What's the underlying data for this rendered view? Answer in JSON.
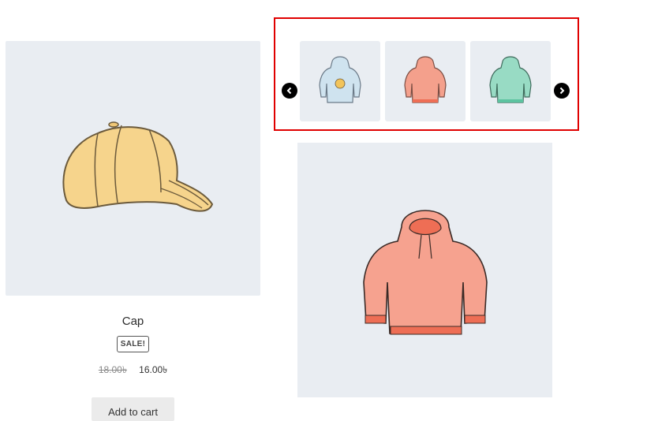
{
  "product": {
    "title": "Cap",
    "sale_badge": "SALE!",
    "price_old": "18.00৳",
    "price_new": "16.00৳",
    "add_to_cart": "Add to cart"
  },
  "gallery": {
    "thumbnails": [
      {
        "name": "hoodie-blue-logo",
        "color": "#cfe3ef"
      },
      {
        "name": "hoodie-pink",
        "color": "#f4a08c"
      },
      {
        "name": "hoodie-green",
        "color": "#98dbc4"
      }
    ],
    "prev_icon": "chevron-left-icon",
    "next_icon": "chevron-right-icon",
    "highlight_color": "#e00000"
  }
}
